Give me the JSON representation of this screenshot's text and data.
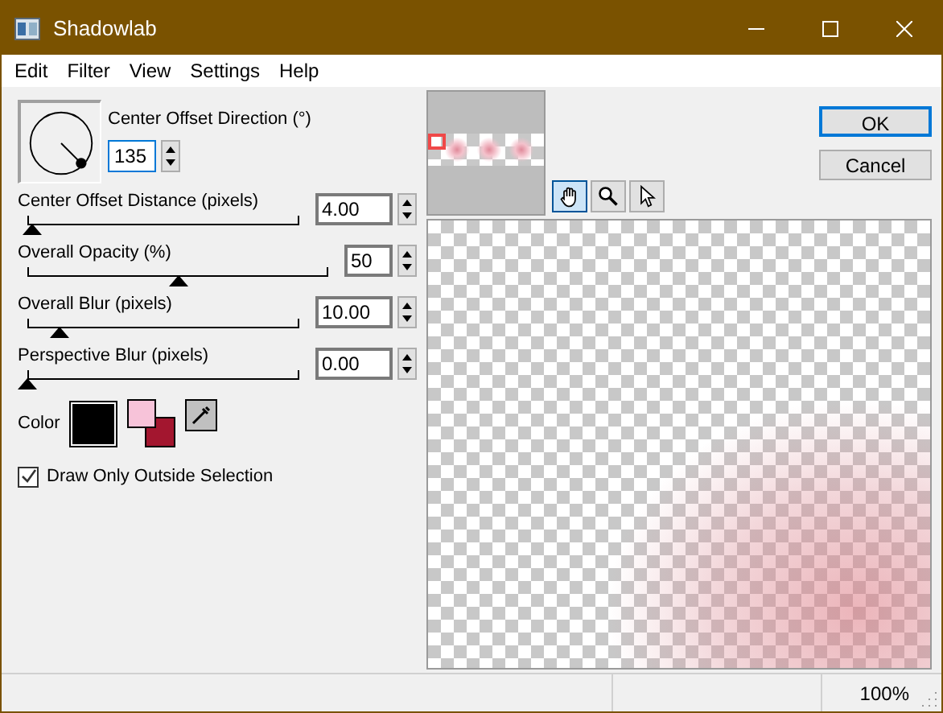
{
  "window": {
    "title": "Shadowlab"
  },
  "menu": [
    "Edit",
    "Filter",
    "View",
    "Settings",
    "Help"
  ],
  "direction": {
    "label": "Center Offset Direction (°)",
    "value": "135"
  },
  "sliders": [
    {
      "label": "Center Offset Distance (pixels)",
      "value": "4.00",
      "level": 0.02
    },
    {
      "label": "Overall Opacity (%)",
      "value": "50",
      "level": 0.5
    },
    {
      "label": "Overall Blur (pixels)",
      "value": "10.00",
      "level": 0.12
    },
    {
      "label": "Perspective Blur (pixels)",
      "value": "0.00",
      "level": 0
    }
  ],
  "color": {
    "label": "Color"
  },
  "outside_selection": {
    "label": "Draw Only Outside Selection",
    "checked": true
  },
  "tools": [
    {
      "kind": "hand",
      "selected": true
    },
    {
      "kind": "zoom",
      "selected": false
    },
    {
      "kind": "pointer",
      "selected": false
    }
  ],
  "buttons": [
    {
      "label": "OK",
      "default": true
    },
    {
      "label": "Cancel",
      "default": false
    }
  ],
  "status_bar": {
    "zoom": "100%"
  }
}
